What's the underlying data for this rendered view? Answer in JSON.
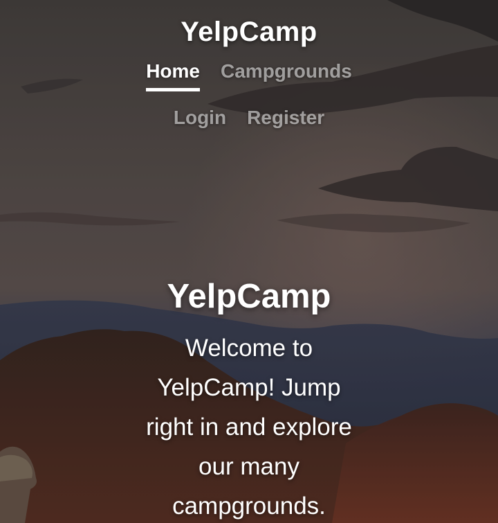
{
  "header": {
    "brand": "YelpCamp",
    "nav": {
      "home": "Home",
      "campgrounds": "Campgrounds",
      "login": "Login",
      "register": "Register"
    }
  },
  "hero": {
    "title": "YelpCamp",
    "text": "Welcome to YelpCamp! Jump right in and explore our many campgrounds."
  }
}
